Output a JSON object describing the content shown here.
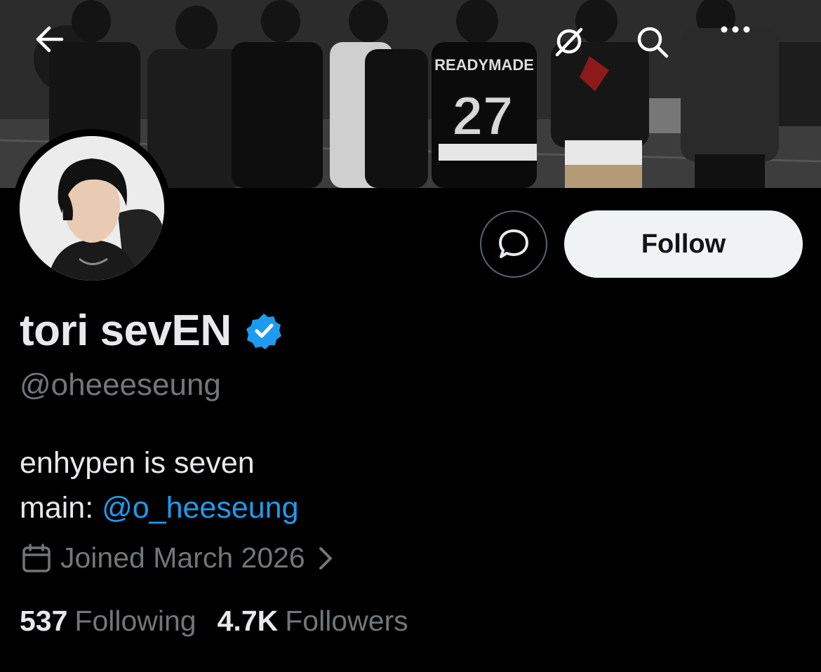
{
  "profile": {
    "display_name": "tori sevEN",
    "handle": "@oheeeseung",
    "verified": true,
    "bio_line1": "enhypen is seven",
    "bio_main_prefix": "main: ",
    "bio_mention": "@o_heeseung",
    "joined": "Joined March 2026",
    "following_count": "537",
    "following_label": "Following",
    "followers_count": "4.7K",
    "followers_label": "Followers"
  },
  "banner": {
    "jersey_text": "READYMADE",
    "jersey_number": "27"
  },
  "actions": {
    "follow_label": "Follow"
  },
  "icons": {
    "back": "arrow-left-icon",
    "grok": "grok-icon",
    "search": "search-icon",
    "more": "more-horizontal-icon",
    "message": "message-bubble-icon",
    "verified": "verified-badge-icon",
    "calendar": "calendar-icon",
    "chevron": "chevron-right-icon"
  },
  "colors": {
    "background": "#000000",
    "accent": "#1d9bf0",
    "muted_text": "#71767b",
    "primary_text": "#e7e9ea",
    "follow_bg": "#eff3f4"
  }
}
